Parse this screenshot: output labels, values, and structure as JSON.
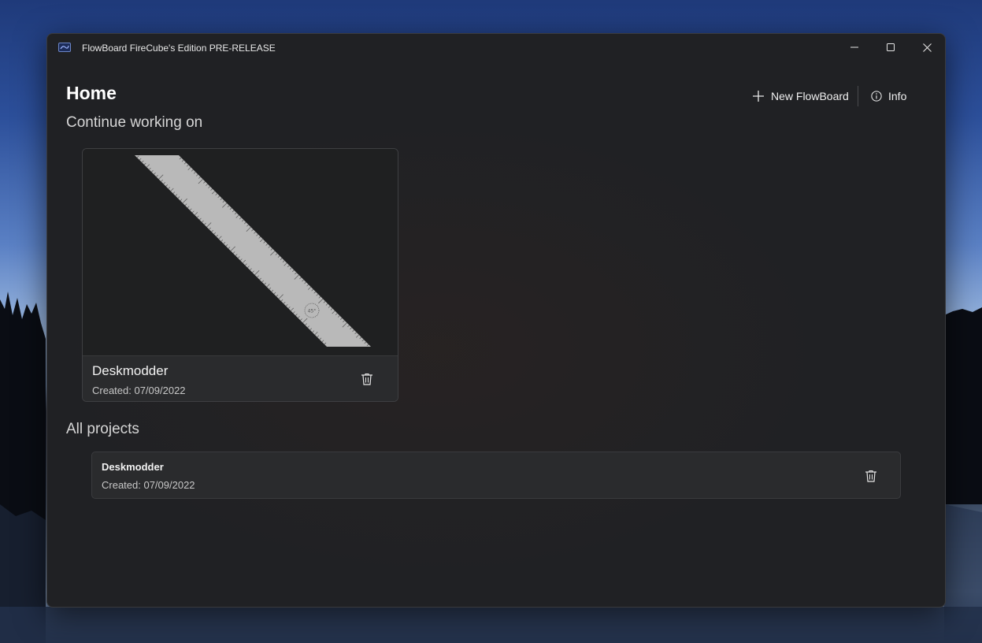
{
  "window": {
    "title": "FlowBoard FireCube's Edition PRE-RELEASE",
    "app_icon": "flowboard-app-icon",
    "controls": {
      "minimize_icon": "minimize-icon",
      "maximize_icon": "maximize-icon",
      "close_icon": "close-icon"
    }
  },
  "header": {
    "title": "Home",
    "new_label": "New FlowBoard",
    "new_icon": "plus-icon",
    "info_label": "Info",
    "info_icon": "info-icon"
  },
  "continue_section": {
    "title": "Continue working on",
    "cards": [
      {
        "name": "Deskmodder",
        "created": "Created: 07/09/2022",
        "preview": "ruler-preview",
        "ruler_angle_label": "45°",
        "delete_icon": "trash-icon"
      }
    ]
  },
  "all_projects_section": {
    "title": "All projects",
    "items": [
      {
        "name": "Deskmodder",
        "created": "Created: 07/09/2022",
        "delete_icon": "trash-icon"
      }
    ]
  },
  "colors": {
    "window_bg": "#202124",
    "card_bg": "#2a2b2d",
    "ruler": "#b9b9b9",
    "text_primary": "#ffffff",
    "text_secondary": "#c8c8c8"
  }
}
